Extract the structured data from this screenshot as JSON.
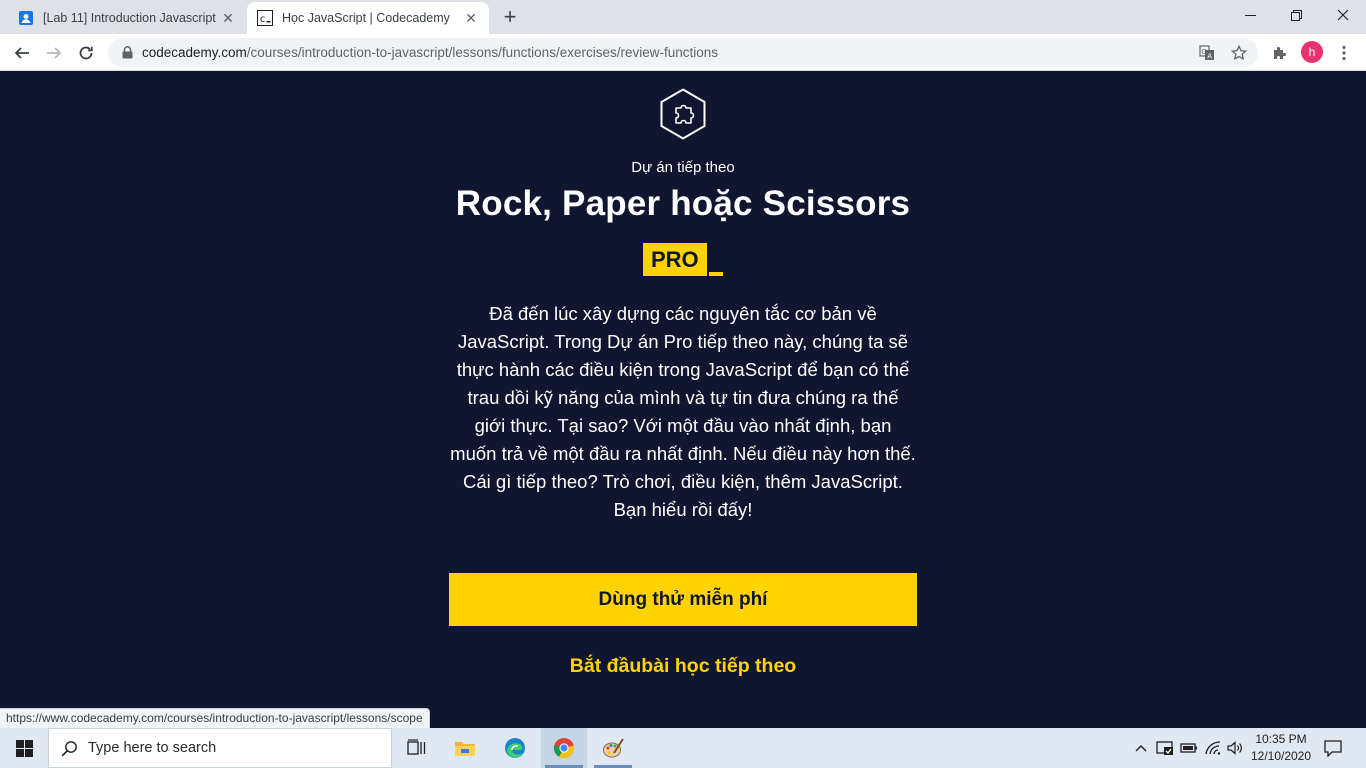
{
  "browser": {
    "tabs": [
      {
        "title": "[Lab 11] Introduction Javascript",
        "favicon": "user-doc-icon",
        "active": false
      },
      {
        "title": "Học JavaScript | Codecademy",
        "favicon": "codecademy-icon",
        "active": true
      }
    ],
    "close_glyph": "✕",
    "new_tab_glyph": "+",
    "url_domain": "codecademy.com",
    "url_path": "/courses/introduction-to-javascript/lessons/functions/exercises/review-functions",
    "profile_initial": "h"
  },
  "page": {
    "eyebrow": "Dự án tiếp theo",
    "title": "Rock, Paper hoặc Scissors",
    "badge": "PRO",
    "description": "Đã đến lúc xây dựng các nguyên tắc cơ bản về JavaScript. Trong Dự án Pro tiếp theo này, chúng ta sẽ thực hành các điều kiện trong JavaScript để bạn có thể trau dồi kỹ năng của mình và tự tin đưa chúng ra thế giới thực. Tại sao? Với một đầu vào nhất định, bạn muốn trả về một đầu ra nhất định. Nếu điều này hơn thế. Cái gì tiếp theo? Trò chơi, điều kiện, thêm JavaScript. Bạn hiểu rồi đấy!",
    "primary_button": "Dùng thử miễn phí",
    "secondary_link": "Bắt đầubài học tiếp theo",
    "accent_color": "#ffd300",
    "background_color": "#10162f"
  },
  "status_bar": {
    "hover_url": "https://www.codecademy.com/courses/introduction-to-javascript/lessons/scope"
  },
  "taskbar": {
    "search_placeholder": "Type here to search",
    "apps": [
      "task-view-icon",
      "file-explorer-icon",
      "edge-icon",
      "chrome-icon",
      "paint-icon"
    ],
    "time": "10:35 PM",
    "date": "12/10/2020"
  }
}
